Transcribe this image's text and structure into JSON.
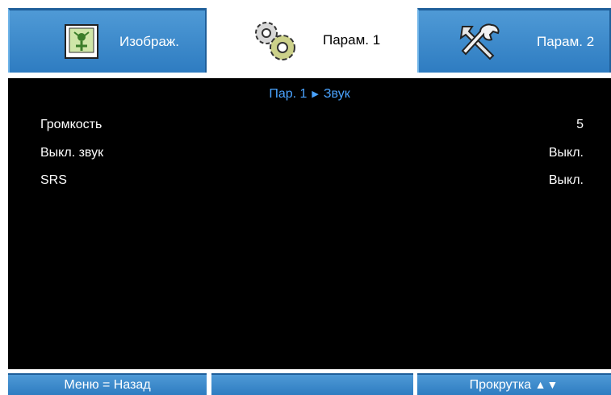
{
  "tabs": [
    {
      "label": "Изображ.",
      "icon": "image-settings-icon",
      "active": false
    },
    {
      "label": "Парам. 1",
      "icon": "gears-icon",
      "active": true
    },
    {
      "label": "Парам. 2",
      "icon": "tools-icon",
      "active": false
    }
  ],
  "breadcrumb": {
    "parent": "Пар. 1",
    "separator": "▶",
    "current": "Звук"
  },
  "menu": {
    "items": [
      {
        "label": "Громкость",
        "value": "5"
      },
      {
        "label": "Выкл. звук",
        "value": "Выкл."
      },
      {
        "label": "SRS",
        "value": "Выкл."
      }
    ]
  },
  "footer": {
    "back": "Меню = Назад",
    "middle": "",
    "scroll": "Прокрутка",
    "scroll_arrows": "▲▼"
  },
  "colors": {
    "tab_blue": "#2e7cc1",
    "content_bg": "#000000",
    "breadcrumb": "#4aa3ff"
  }
}
